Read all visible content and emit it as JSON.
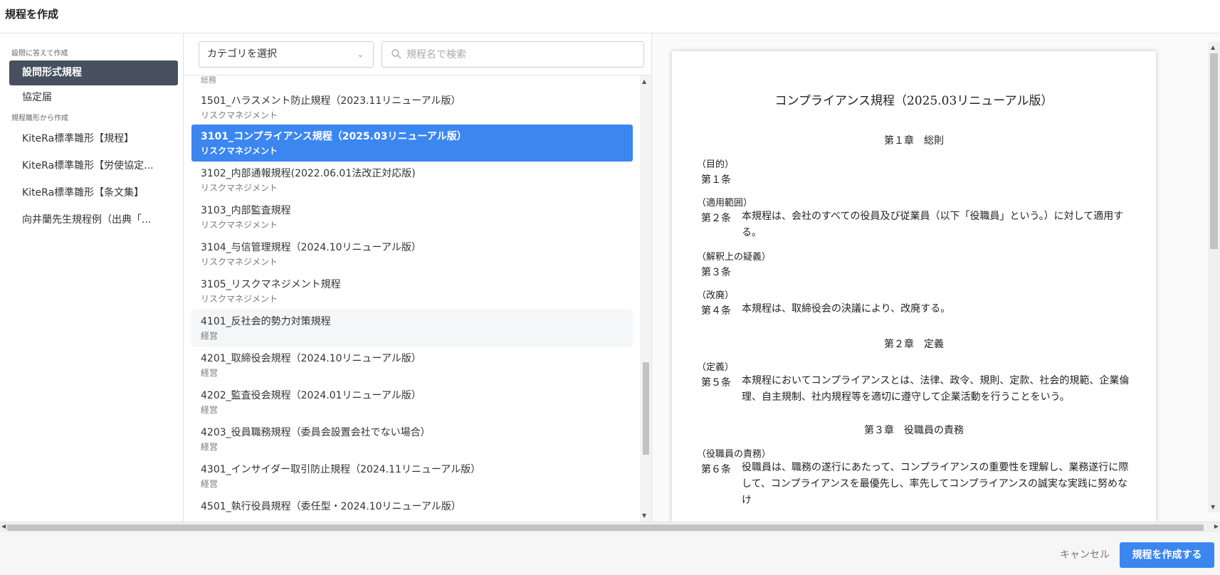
{
  "header": {
    "title": "規程を作成"
  },
  "sidebar": {
    "sections": [
      {
        "label": "設問に答えて作成"
      },
      {
        "label": "規程雛形から作成"
      }
    ],
    "items": [
      {
        "label": "設問形式規程",
        "active": true
      },
      {
        "label": "協定届"
      },
      {
        "label": "KiteRa標準雛形【規程】"
      },
      {
        "label": "KiteRa標準雛形【労使協定..."
      },
      {
        "label": "KiteRa標準雛形【条文集】"
      },
      {
        "label": "向井蘭先生規程例（出典「..."
      }
    ]
  },
  "list": {
    "category_select": "カテゴリを選択",
    "search_placeholder": "規程名で検索",
    "clipped_top_label": "総務",
    "items": [
      {
        "title": "1501_ハラスメント防止規程（2023.11リニューアル版）",
        "category": "リスクマネジメント"
      },
      {
        "title": "3101_コンプライアンス規程（2025.03リニューアル版）",
        "category": "リスクマネジメント",
        "selected": true
      },
      {
        "title": "3102_内部通報規程(2022.06.01法改正対応版)",
        "category": "リスクマネジメント"
      },
      {
        "title": "3103_内部監査規程",
        "category": "リスクマネジメント"
      },
      {
        "title": "3104_与信管理規程（2024.10リニューアル版）",
        "category": "リスクマネジメント"
      },
      {
        "title": "3105_リスクマネジメント規程",
        "category": "リスクマネジメント"
      },
      {
        "title": "4101_反社会的勢力対策規程",
        "category": "経営",
        "hover": true
      },
      {
        "title": "4201_取締役会規程（2024.10リニューアル版）",
        "category": "経営"
      },
      {
        "title": "4202_監査役会規程（2024.01リニューアル版）",
        "category": "経営"
      },
      {
        "title": "4203_役員職務規程（委員会設置会社でない場合）",
        "category": "経営"
      },
      {
        "title": "4301_インサイダー取引防止規程（2024.11リニューアル版）",
        "category": "経営"
      },
      {
        "title": "4501_執行役員規程（委任型・2024.10リニューアル版）",
        "category": ""
      }
    ]
  },
  "preview": {
    "title": "コンプライアンス規程（2025.03リニューアル版）",
    "chapters": [
      "第１章　総則",
      "第２章　定義",
      "第３章　役職員の責務"
    ],
    "articles": [
      {
        "heading": "（目的）",
        "number": "第１条",
        "lines": []
      },
      {
        "heading": "（適用範囲）",
        "number": "第２条",
        "lines": [
          "本規程は、会社のすべての役員及び従業員（以下「役職員」という。）に対して適用す",
          "る。"
        ]
      },
      {
        "heading": "（解釈上の疑義）",
        "number": "第３条",
        "lines": []
      },
      {
        "heading": "（改廃）",
        "number": "第４条",
        "lines": [
          "本規程は、取締役会の決議により、改廃する。"
        ]
      },
      {
        "heading": "（定義）",
        "number": "第５条",
        "lines": [
          "本規程においてコンプライアンスとは、法律、政令、規則、定款、社会的規範、企業倫",
          "理、自主規制、社内規程等を適切に遵守して企業活動を行うことをいう。"
        ]
      },
      {
        "heading": "（役職員の責務）",
        "number": "第６条",
        "lines": [
          "役職員は、職務の遂行にあたって、コンプライアンスの重要性を理解し、業務遂行に際",
          "して、コンプライアンスを最優先し、率先してコンプライアンスの誠実な実践に努めなけ"
        ]
      }
    ]
  },
  "footer": {
    "cancel_label": "キャンセル",
    "create_label": "規程を作成する"
  },
  "colors": {
    "accent": "#3c86f0",
    "sidebar_active": "#46505e"
  }
}
